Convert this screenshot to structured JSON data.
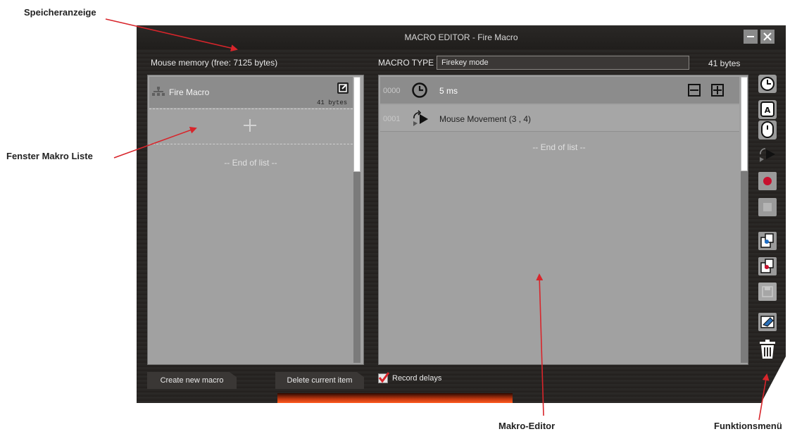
{
  "annotations": {
    "memory_display": "Speicheranzeige",
    "macro_list_window": "Fenster Makro Liste",
    "macro_editor": "Makro-Editor",
    "function_menu": "Funktionsmenü"
  },
  "window": {
    "title": "MACRO EDITOR - Fire Macro",
    "minimize_icon": "minimize-icon",
    "close_icon": "close-icon"
  },
  "header": {
    "memory_label": "Mouse memory (free: 7125 bytes)",
    "macro_type_label": "MACRO TYPE",
    "macro_type_value": "Firekey mode",
    "bytes": "41 bytes"
  },
  "macro_list": {
    "items": [
      {
        "name": "Fire Macro",
        "size": "41 bytes",
        "icon": "tree-icon",
        "action_icon": "edit-icon"
      }
    ],
    "add_icon": "plus-icon",
    "end_of_list": "-- End of list --"
  },
  "editor": {
    "rows": [
      {
        "index": "0000",
        "icon": "clock-icon",
        "text": "5 ms"
      },
      {
        "index": "0001",
        "icon": "mouse-move-icon",
        "text": "Mouse Movement (3 , 4)"
      }
    ],
    "end_of_list": "-- End of list --",
    "collapse_icon": "minus-square-icon",
    "expand_icon": "plus-square-icon"
  },
  "function_menu": [
    "clock-icon",
    "keyboard-mouse-icon",
    "mouse-move-icon",
    "record-icon",
    "stop-icon",
    "copy-icon",
    "paste-icon",
    "save-icon",
    "eraser-icon",
    "trash-icon"
  ],
  "bottom": {
    "create_button": "Create new macro",
    "delete_button": "Delete current item",
    "record_delays": "Record delays",
    "record_delays_checked": true
  },
  "colors": {
    "annotation_arrow": "#d8252b",
    "record_red": "#c8102e",
    "panel_gray": "#a1a1a1"
  }
}
